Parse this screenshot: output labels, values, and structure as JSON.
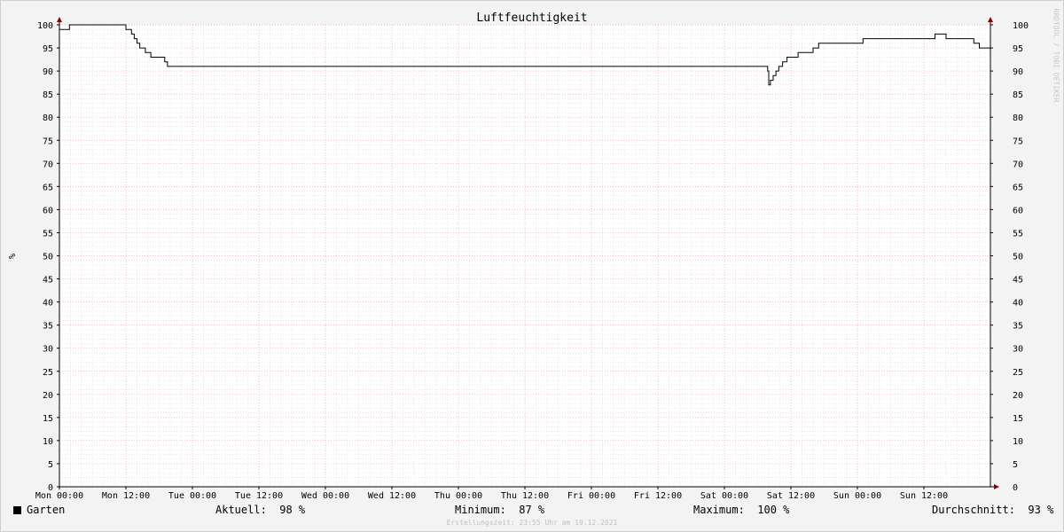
{
  "chart_data": {
    "type": "line",
    "title": "Luftfeuchtigkeit",
    "ylabel": "%",
    "ylim": [
      0,
      100
    ],
    "y_ticks": [
      0,
      5,
      10,
      15,
      20,
      25,
      30,
      35,
      40,
      45,
      50,
      55,
      60,
      65,
      70,
      75,
      80,
      85,
      90,
      95,
      100
    ],
    "x_range_hours": [
      0,
      168
    ],
    "x_ticks": [
      {
        "h": 0,
        "label": "Mon 00:00"
      },
      {
        "h": 12,
        "label": "Mon 12:00"
      },
      {
        "h": 24,
        "label": "Tue 00:00"
      },
      {
        "h": 36,
        "label": "Tue 12:00"
      },
      {
        "h": 48,
        "label": "Wed 00:00"
      },
      {
        "h": 60,
        "label": "Wed 12:00"
      },
      {
        "h": 72,
        "label": "Thu 00:00"
      },
      {
        "h": 84,
        "label": "Thu 12:00"
      },
      {
        "h": 96,
        "label": "Fri 00:00"
      },
      {
        "h": 108,
        "label": "Fri 12:00"
      },
      {
        "h": 120,
        "label": "Sat 00:00"
      },
      {
        "h": 132,
        "label": "Sat 12:00"
      },
      {
        "h": 144,
        "label": "Sun 00:00"
      },
      {
        "h": 156,
        "label": "Sun 12:00"
      }
    ],
    "grid": true,
    "series": [
      {
        "name": "Garten",
        "color": "#000000",
        "x_hours": [
          0,
          1.5,
          1.8,
          11.7,
          12,
          12.5,
          13,
          13.5,
          14,
          14.5,
          15,
          15.5,
          16,
          16.5,
          17,
          18,
          19,
          19.5,
          20,
          127.5,
          127.8,
          128,
          128.3,
          128.8,
          129.3,
          129.8,
          130.5,
          131.3,
          132.2,
          133.3,
          134.5,
          136,
          137,
          142,
          145,
          150,
          158,
          159,
          160,
          164,
          165,
          166,
          168
        ],
        "values": [
          99,
          99,
          100,
          100,
          99,
          99,
          98,
          97,
          96,
          95,
          95,
          94,
          94,
          93,
          93,
          93,
          92,
          91,
          91,
          91,
          90,
          87,
          88,
          89,
          90,
          91,
          92,
          93,
          93,
          94,
          94,
          95,
          96,
          96,
          97,
          97,
          98,
          98,
          97,
          97,
          96,
          95,
          95
        ]
      }
    ]
  },
  "legend": {
    "series_name": "Garten",
    "aktuell_label": "Aktuell:",
    "aktuell_value": "98 %",
    "minimum_label": "Minimum:",
    "minimum_value": "87 %",
    "maximum_label": "Maximum:",
    "maximum_value": "100 %",
    "durchschnitt_label": "Durchschnitt:",
    "durchschnitt_value": "93 %"
  },
  "footer": "Erstellungszeit: 23:55 Uhr am 19.12.2021",
  "side_credit": "RRDTOOL / TOBI OETIKER",
  "colors": {
    "line": "#000000",
    "grid_major": "#f0a0a0",
    "grid_minor": "#d8d8d8",
    "axis_arrow": "#8b0000",
    "background": "#f3f3f3",
    "plot_bg": "#ffffff"
  }
}
